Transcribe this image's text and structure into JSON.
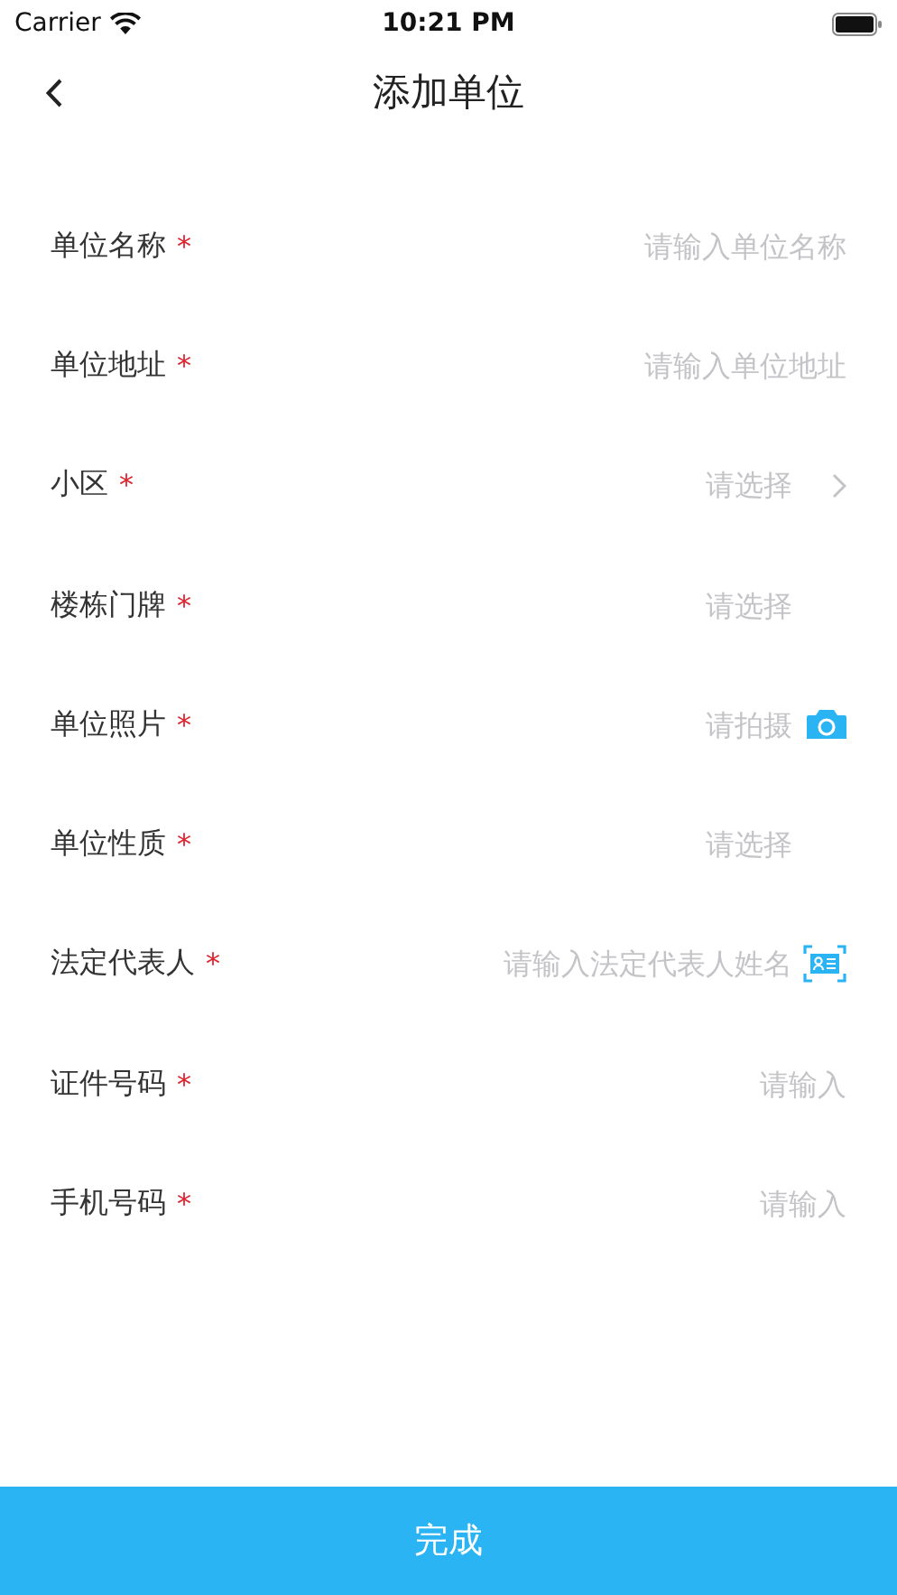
{
  "status_bar": {
    "carrier": "Carrier",
    "time": "10:21 PM"
  },
  "nav": {
    "title": "添加单位"
  },
  "fields": [
    {
      "label": "单位名称",
      "required": true,
      "marker": "*",
      "kind": "text",
      "placeholder": "请输入单位名称"
    },
    {
      "label": "单位地址",
      "required": true,
      "marker": "*",
      "kind": "text",
      "placeholder": "请输入单位地址"
    },
    {
      "label": "小区",
      "required": true,
      "marker": "*",
      "kind": "select",
      "placeholder": "请选择"
    },
    {
      "label": "楼栋门牌",
      "required": true,
      "marker": "*",
      "kind": "picker",
      "placeholder": "请选择"
    },
    {
      "label": "单位照片",
      "required": true,
      "marker": "*",
      "kind": "photo",
      "placeholder": "请拍摄"
    },
    {
      "label": "单位性质",
      "required": true,
      "marker": "*",
      "kind": "picker",
      "placeholder": "请选择"
    },
    {
      "label": "法定代表人",
      "required": true,
      "marker": "*",
      "kind": "scan",
      "placeholder": "请输入法定代表人姓名"
    },
    {
      "label": "证件号码",
      "required": true,
      "marker": "*",
      "kind": "text",
      "placeholder": "请输入"
    },
    {
      "label": "手机号码",
      "required": true,
      "marker": "*",
      "kind": "text",
      "placeholder": "请输入"
    }
  ],
  "submit": {
    "label": "完成"
  }
}
